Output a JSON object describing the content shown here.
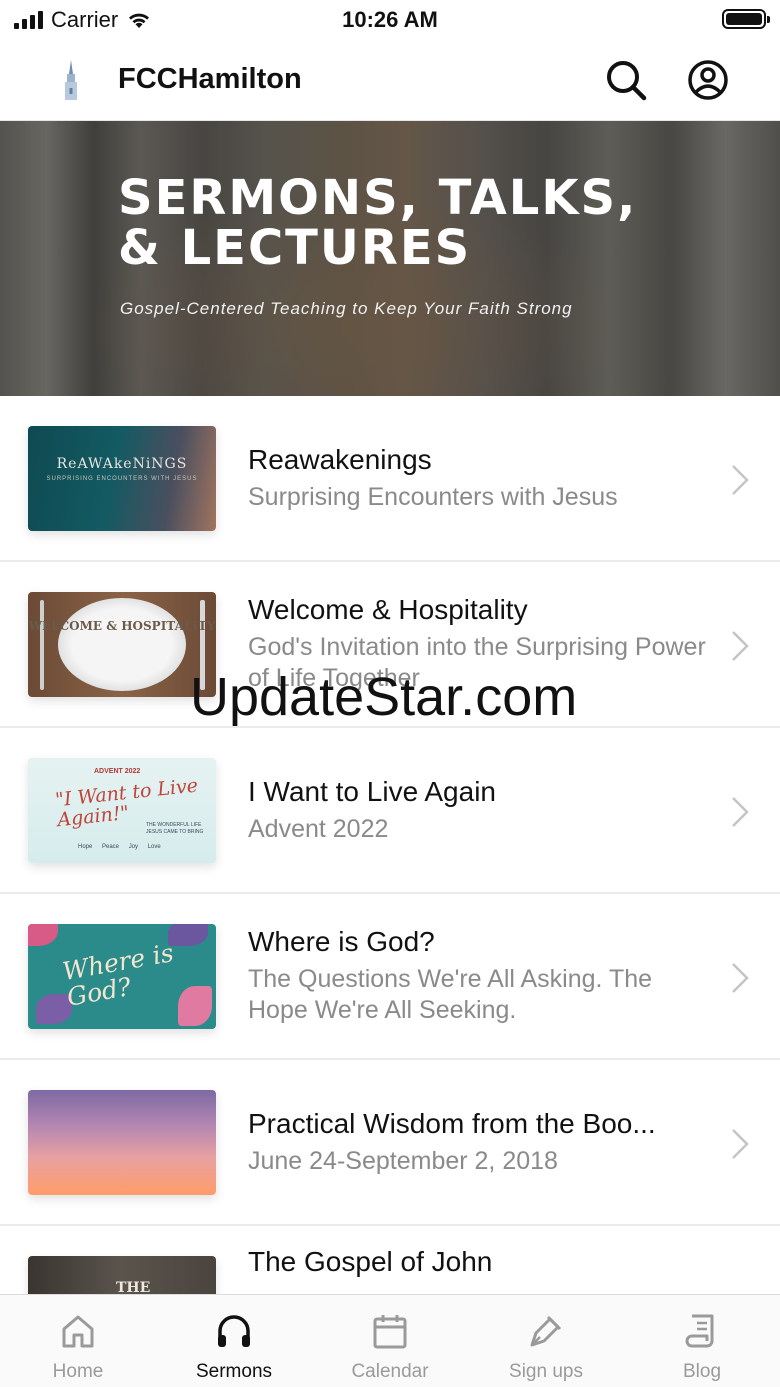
{
  "status_bar": {
    "carrier": "Carrier",
    "time": "10:26 AM"
  },
  "nav": {
    "title": "FCCHamilton",
    "logo_icon": "church-steeple-icon",
    "search_icon": "search-icon",
    "account_icon": "account-circle-icon"
  },
  "hero": {
    "title": "SERMONS, TALKS, & LECTURES",
    "subtitle": "Gospel-Centered Teaching to Keep Your Faith Strong"
  },
  "series": [
    {
      "title": "Reawakenings",
      "subtitle": "Surprising Encounters with Jesus",
      "thumb_text": "ReAWAkeNiNGS",
      "thumb_subtext": "SURPRISING ENCOUNTERS WITH JESUS"
    },
    {
      "title": "Welcome & Hospitality",
      "subtitle": "God's Invitation into the Surprising Power of Life Together",
      "thumb_text": "WELCOME & HOSPITALITY"
    },
    {
      "title": "I Want to Live Again",
      "subtitle": "Advent 2022",
      "thumb_text_top": "ADVENT 2022",
      "thumb_text_main": "\"I Want to Live Again!\"",
      "thumb_text_side": "THE WONDERFUL LIFE JESUS CAME TO BRING",
      "thumb_text_bottom": "Hope Peace Joy Love"
    },
    {
      "title": "Where is God?",
      "subtitle": "The Questions We're All Asking. The Hope We're All Seeking.",
      "thumb_text": "Where is God?"
    },
    {
      "title": "Practical Wisdom from the Boo...",
      "subtitle": "June 24-September 2, 2018"
    },
    {
      "title": "The Gospel of John",
      "subtitle": "",
      "thumb_text": "THE GOSPEL"
    }
  ],
  "watermark": "UpdateStar.com",
  "tabs": [
    {
      "label": "Home",
      "icon": "home-icon",
      "active": false
    },
    {
      "label": "Sermons",
      "icon": "headphones-icon",
      "active": true
    },
    {
      "label": "Calendar",
      "icon": "calendar-icon",
      "active": false
    },
    {
      "label": "Sign ups",
      "icon": "pen-icon",
      "active": false
    },
    {
      "label": "Blog",
      "icon": "scroll-icon",
      "active": false
    }
  ],
  "colors": {
    "tab_active": "#111111",
    "tab_inactive": "#9a9a9a",
    "subtitle_gray": "#8a8a8a"
  }
}
